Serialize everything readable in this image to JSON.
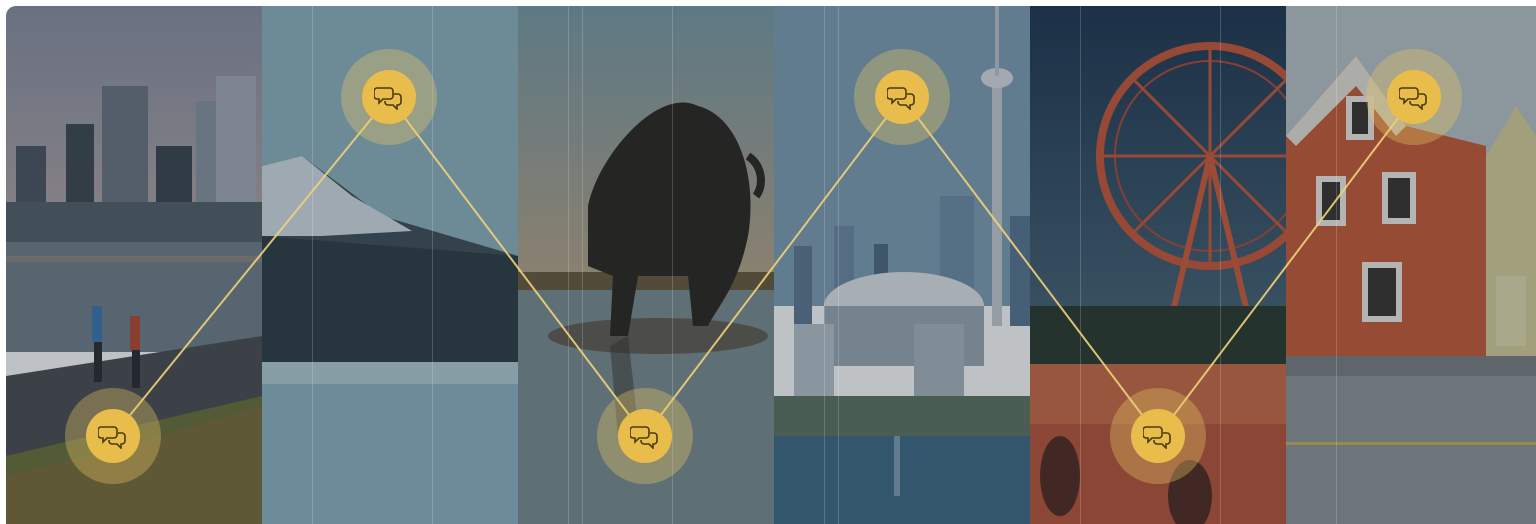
{
  "banner": {
    "panels": [
      {
        "scene": "vancouver-seawall-joggers"
      },
      {
        "scene": "snowy-mountain-lake"
      },
      {
        "scene": "bison-statue-reflection"
      },
      {
        "scene": "toronto-skyline-cn-tower"
      },
      {
        "scene": "ferris-wheel-at-dusk"
      },
      {
        "scene": "red-wooden-house"
      }
    ],
    "accent_color": "#e9bd4c",
    "line_color": "#f0d27a",
    "markers": [
      {
        "icon": "chat-bubbles-icon"
      },
      {
        "icon": "chat-bubbles-icon"
      },
      {
        "icon": "chat-bubbles-icon"
      },
      {
        "icon": "chat-bubbles-icon"
      },
      {
        "icon": "chat-bubbles-icon"
      },
      {
        "icon": "chat-bubbles-icon"
      }
    ]
  }
}
